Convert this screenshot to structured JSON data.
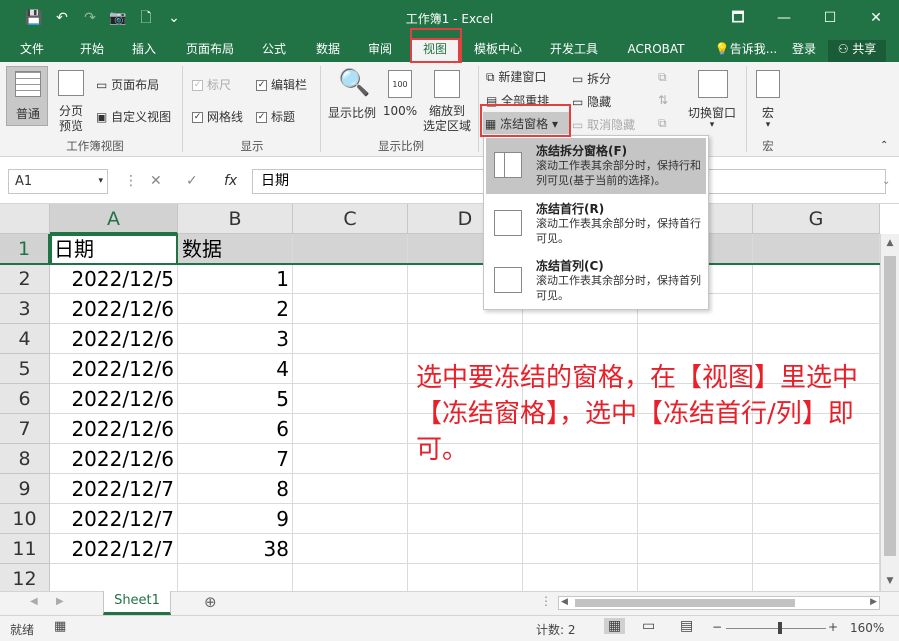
{
  "title": "工作簿1 - Excel",
  "qat": {
    "save": "💾",
    "undo": "↶",
    "redo": "↷",
    "camera": "📷",
    "new": "🗋",
    "more": "⌄"
  },
  "window": {
    "restore": "🗖",
    "minimize": "—",
    "maximize": "☐",
    "close": "✕"
  },
  "tabs": [
    "文件",
    "开始",
    "插入",
    "页面布局",
    "公式",
    "数据",
    "审阅",
    "视图",
    "模板中心",
    "开发工具",
    "ACROBAT"
  ],
  "tell_me": "告诉我...",
  "login": "登录",
  "share": "共享",
  "ribbon": {
    "normal": "普通",
    "page_break": "分页\n预览",
    "page_layout": "页面布局",
    "custom_view": "自定义视图",
    "group_views": "工作簿视图",
    "ruler": "标尺",
    "formula_bar": "编辑栏",
    "gridlines": "网格线",
    "headings": "标题",
    "group_show": "显示",
    "zoom": "显示比例",
    "zoom100": "100%",
    "zoom_sel": "缩放到\n选定区域",
    "group_zoom": "显示比例",
    "new_window": "新建窗口",
    "arrange_all": "全部重排",
    "freeze": "冻结窗格",
    "split": "拆分",
    "hide": "隐藏",
    "unhide": "取消隐藏",
    "switch_window": "切换窗口",
    "macro": "宏",
    "group_macro": "宏"
  },
  "namebox": "A1",
  "formula": "日期",
  "columns": [
    "A",
    "B",
    "C",
    "D",
    "E",
    "F",
    "G"
  ],
  "rows": [
    "1",
    "2",
    "3",
    "4",
    "5",
    "6",
    "7",
    "8",
    "9",
    "10",
    "11",
    "12"
  ],
  "cells": {
    "header": [
      "日期",
      "数据"
    ],
    "data": [
      [
        "2022/12/5",
        "1"
      ],
      [
        "2022/12/6",
        "2"
      ],
      [
        "2022/12/6",
        "3"
      ],
      [
        "2022/12/6",
        "4"
      ],
      [
        "2022/12/6",
        "5"
      ],
      [
        "2022/12/6",
        "6"
      ],
      [
        "2022/12/6",
        "7"
      ],
      [
        "2022/12/7",
        "8"
      ],
      [
        "2022/12/7",
        "9"
      ],
      [
        "2022/12/7",
        "38"
      ]
    ]
  },
  "annotation": "选中要冻结的窗格，在【视图】里选中【冻结窗格】，选中【冻结首行/列】即可。",
  "menu": [
    {
      "title": "冻结拆分窗格(F)",
      "desc": "滚动工作表其余部分时，保持行和列可见(基于当前的选择)。"
    },
    {
      "title": "冻结首行(R)",
      "desc": "滚动工作表其余部分时，保持首行可见。"
    },
    {
      "title": "冻结首列(C)",
      "desc": "滚动工作表其余部分时，保持首列可见。"
    }
  ],
  "sheet": "Sheet1",
  "status": {
    "ready": "就绪",
    "count": "计数: 2",
    "zoom": "160%"
  },
  "colors": {
    "accent": "#217346",
    "highlight": "#e04040",
    "note": "#e8202a"
  }
}
